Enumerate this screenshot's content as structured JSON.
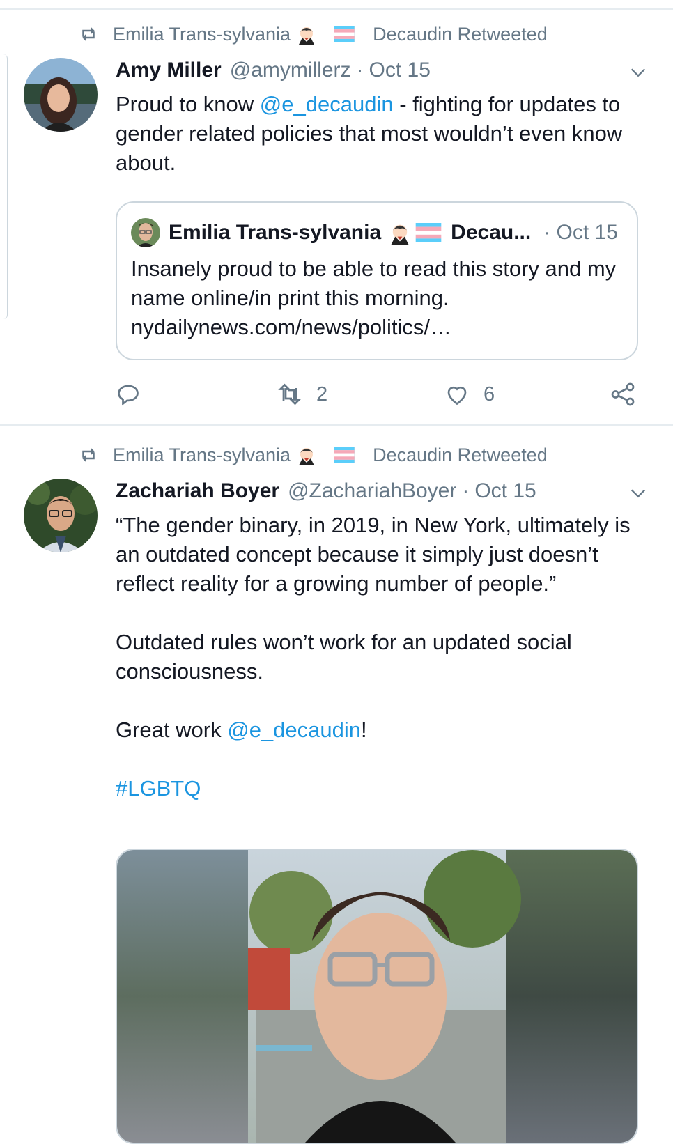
{
  "colors": {
    "accent": "#1b95e0",
    "secondary_text": "#657786",
    "divider": "#e6ecf0"
  },
  "tweets": [
    {
      "retweet_line": {
        "name": "Emilia Trans-sylvania",
        "suffix": "Decaudin Retweeted"
      },
      "author": {
        "name": "Amy Miller",
        "handle": "@amymillerz",
        "date": "Oct 15"
      },
      "text": {
        "before": "Proud to know ",
        "mention": "@e_decaudin",
        "after": " - fighting for updates to gender related policies that most wouldn’t even know about."
      },
      "quote": {
        "name": "Emilia Trans-sylvania",
        "name_suffix": "Decau...",
        "date": "· Oct 15",
        "text": "Insanely proud to be able to read this story and my name online/in print this morning. nydailynews.com/news/politics/…"
      },
      "actions": {
        "reply_count": "",
        "retweet_count": "2",
        "like_count": "6"
      }
    },
    {
      "retweet_line": {
        "name": "Emilia Trans-sylvania",
        "suffix": "Decaudin Retweeted"
      },
      "author": {
        "name": "Zachariah Boyer",
        "handle": "@ZachariahBoyer",
        "date": "Oct 15"
      },
      "text": {
        "p1": "“The gender binary, in 2019, in New York, ultimately is an outdated concept because it simply just doesn’t reflect reality for a growing number of people.”",
        "p2": "Outdated rules won’t work for an updated social consciousness.",
        "p3_before": "Great work ",
        "p3_mention": "@e_decaudin",
        "p3_after": "!",
        "hashtag": "#LGBTQ"
      }
    }
  ],
  "icons": [
    "retweet-icon",
    "vampire-emoji-icon",
    "trans-flag-icon",
    "chevron-down-icon",
    "reply-icon",
    "like-icon",
    "share-icon"
  ]
}
